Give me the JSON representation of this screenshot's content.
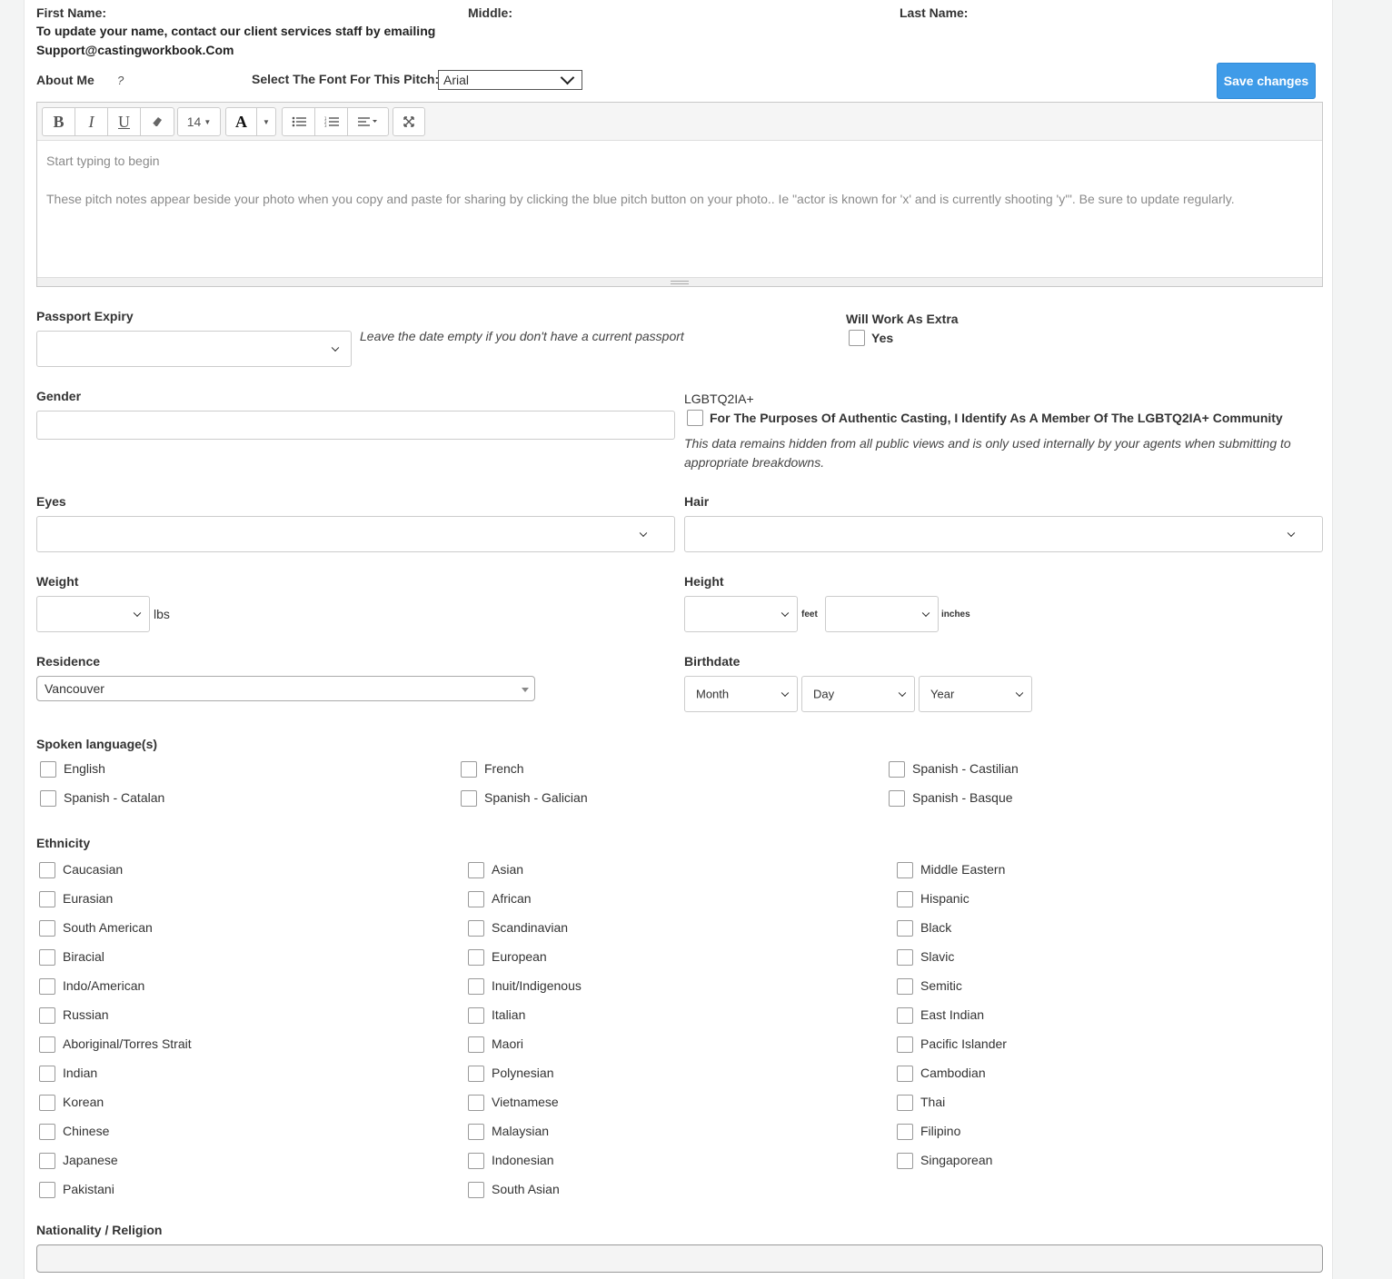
{
  "name_row": {
    "first_label": "First Name:",
    "middle_label": "Middle:",
    "last_label": "Last Name:",
    "update_note_line1": "To update your name, contact our client services staff by emailing",
    "update_note_line2": "Support@castingworkbook.Com"
  },
  "about": {
    "label": "About Me",
    "help": "?",
    "font_label": "Select The Font For This Pitch:",
    "font_value": "Arial",
    "save_label": "Save changes"
  },
  "editor": {
    "font_size": "14",
    "placeholder_line1": "Start typing to begin",
    "placeholder_line2": "These pitch notes appear beside your photo when you copy and paste for sharing by clicking the blue pitch button on your photo.. Ie \"actor is known for 'x' and is currently shooting 'y'\". Be sure to update regularly."
  },
  "passport": {
    "label": "Passport Expiry",
    "value": "",
    "hint": "Leave the date empty if you don't have a current passport"
  },
  "extra": {
    "label": "Will Work As Extra",
    "option": "Yes"
  },
  "gender": {
    "label": "Gender",
    "value": ""
  },
  "lgbtq": {
    "label": "LGBTQ2IA+",
    "option": "For The Purposes Of Authentic Casting, I Identify As A Member Of The LGBTQ2IA+ Community",
    "note_line1": "This data remains hidden from all public views and is only used internally by your agents when submitting to",
    "note_line2": "appropriate breakdowns."
  },
  "eyes": {
    "label": "Eyes",
    "value": ""
  },
  "hair": {
    "label": "Hair",
    "value": ""
  },
  "weight": {
    "label": "Weight",
    "unit": "lbs"
  },
  "height": {
    "label": "Height",
    "feet_unit": "feet",
    "inches_unit": "inches"
  },
  "residence": {
    "label": "Residence",
    "value": "Vancouver"
  },
  "birthdate": {
    "label": "Birthdate",
    "month": "Month",
    "day": "Day",
    "year": "Year"
  },
  "languages": {
    "label": "Spoken language(s)",
    "items": [
      "English",
      "French",
      "Spanish - Castilian",
      "Spanish - Catalan",
      "Spanish - Galician",
      "Spanish - Basque"
    ]
  },
  "ethnicity": {
    "label": "Ethnicity",
    "col1": [
      "Caucasian",
      "Eurasian",
      "South American",
      "Biracial",
      "Indo/American",
      "Russian",
      "Aboriginal/Torres Strait",
      "Indian",
      "Korean",
      "Chinese",
      "Japanese",
      "Pakistani"
    ],
    "col2": [
      "Asian",
      "African",
      "Scandinavian",
      "European",
      "Inuit/Indigenous",
      "Italian",
      "Maori",
      "Polynesian",
      "Vietnamese",
      "Malaysian",
      "Indonesian",
      "South Asian"
    ],
    "col3": [
      "Middle Eastern",
      "Hispanic",
      "Black",
      "Slavic",
      "Semitic",
      "East Indian",
      "Pacific Islander",
      "Cambodian",
      "Thai",
      "Filipino",
      "Singaporean"
    ]
  },
  "nationality": {
    "label": "Nationality / Religion",
    "value": ""
  }
}
